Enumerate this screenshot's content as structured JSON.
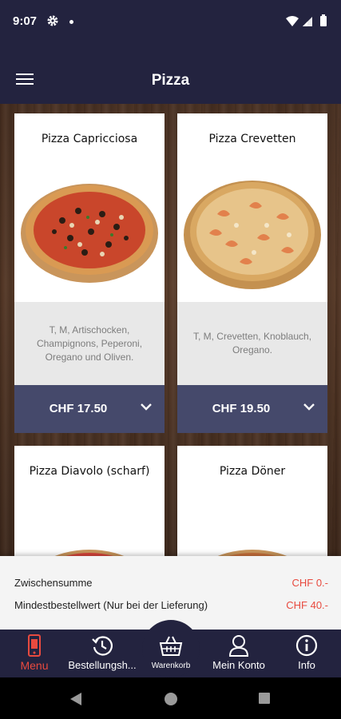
{
  "status_bar": {
    "time": "9:07"
  },
  "header": {
    "title": "Pizza"
  },
  "products": [
    {
      "name": "Pizza Capricciosa",
      "description": "T, M, Artischocken, Champignons, Peperoni, Oregano und Oliven.",
      "price": "CHF 17.50"
    },
    {
      "name": "Pizza Crevetten",
      "description": "T, M, Crevetten, Knoblauch, Oregano.",
      "price": "CHF 19.50"
    },
    {
      "name": "Pizza Diavolo (scharf)"
    },
    {
      "name": "Pizza Döner"
    }
  ],
  "summary": {
    "subtotal_label": "Zwischensumme",
    "subtotal_value": "CHF 0.-",
    "minimum_label": "Mindestbestellwert (Nur bei der Lieferung)",
    "minimum_value": "CHF 40.-"
  },
  "bottom_nav": [
    {
      "label": "Menu",
      "icon": "menu-phone-icon",
      "active": true
    },
    {
      "label": "Bestellungsh...",
      "icon": "history-icon"
    },
    {
      "label": "Warenkorb",
      "icon": "basket-icon"
    },
    {
      "label": "Mein Konto",
      "icon": "user-icon"
    },
    {
      "label": "Info",
      "icon": "info-icon"
    }
  ],
  "colors": {
    "primary": "#23233f",
    "price_bar": "#45496b",
    "accent": "#e84a3f"
  }
}
